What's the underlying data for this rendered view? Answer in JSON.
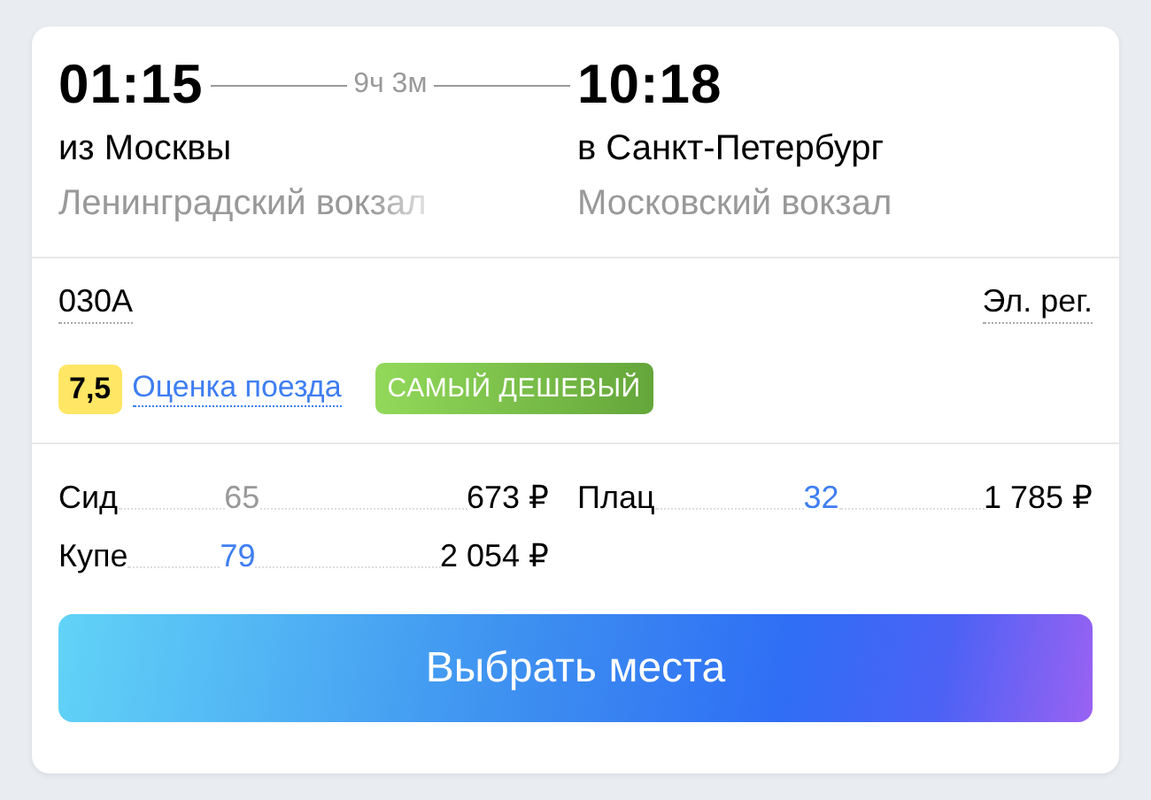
{
  "departure": {
    "time": "01:15",
    "city": "из Москвы",
    "station": "Ленинградский вокзал"
  },
  "duration": "9ч 3м",
  "arrival": {
    "time": "10:18",
    "city": "в Санкт-Петербург",
    "station": "Московский вокзал"
  },
  "train": {
    "number": "030A",
    "type": "Эл. рег."
  },
  "rating": {
    "score": "7,5",
    "link": "Оценка поезда"
  },
  "tag": "САМЫЙ ДЕШЕВЫЙ",
  "fares": [
    {
      "name": "Сид",
      "seats": "65",
      "price": "673 ₽",
      "disabled": true
    },
    {
      "name": "Плац",
      "seats": "32",
      "price": "1 785 ₽",
      "disabled": false
    },
    {
      "name": "Купе",
      "seats": "79",
      "price": "2 054 ₽",
      "disabled": false
    }
  ],
  "button": "Выбрать места"
}
